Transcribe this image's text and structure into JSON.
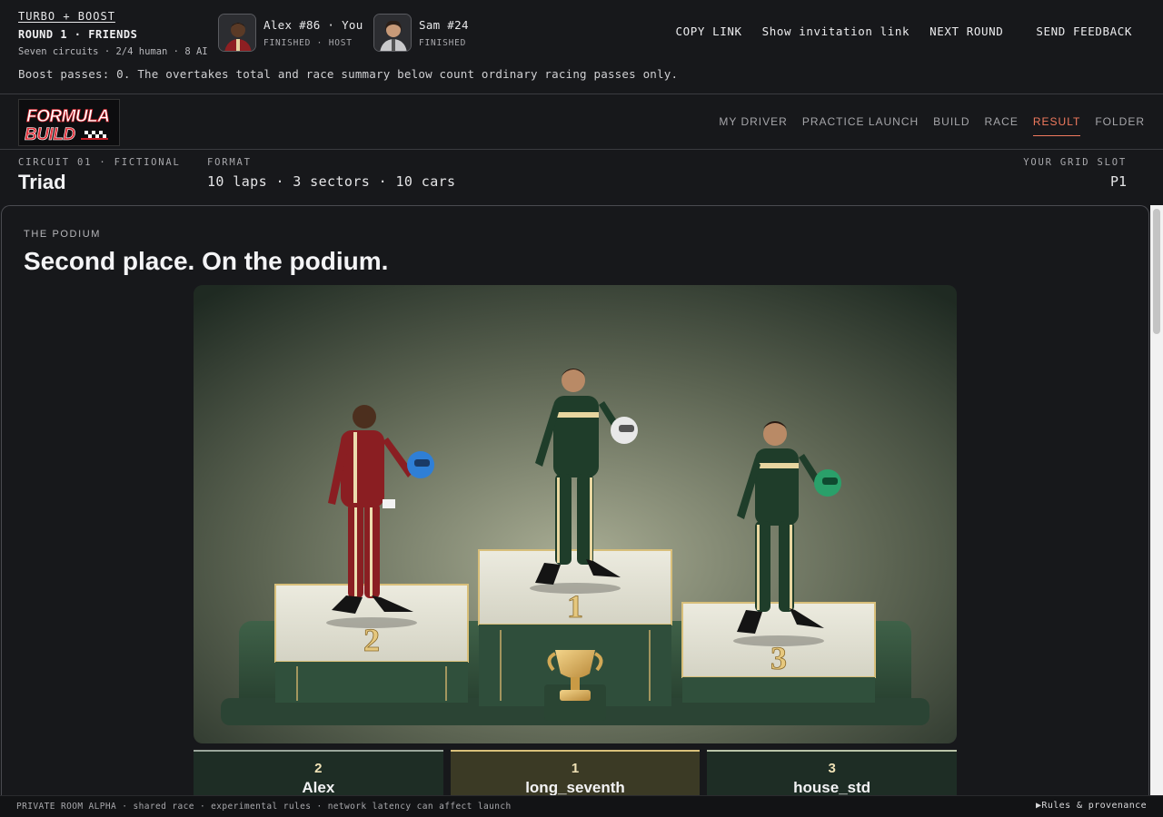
{
  "room": {
    "title": "TURBO + BOOST",
    "round": "ROUND 1 · FRIENDS",
    "meta": "Seven circuits · 2/4 human · 8 AI"
  },
  "players": [
    {
      "name": "Alex #86 · You",
      "status": "FINISHED · HOST",
      "suit_color": "#8e1f22"
    },
    {
      "name": "Sam #24",
      "status": "FINISHED",
      "suit_color": "#c8c8c8"
    }
  ],
  "top_actions": {
    "copy_link": "COPY LINK",
    "show_invite": "Show invitation link",
    "next_round": "NEXT ROUND",
    "send_feedback": "SEND FEEDBACK"
  },
  "boost_note": "Boost passes: 0. The overtakes total and race summary below count ordinary racing passes only.",
  "logo": {
    "line1": "FORMULA",
    "line2": "BUILD"
  },
  "nav": {
    "items": [
      "MY DRIVER",
      "PRACTICE LAUNCH",
      "BUILD",
      "RACE",
      "RESULT",
      "FOLDER"
    ],
    "active": "RESULT"
  },
  "circuit": {
    "label": "CIRCUIT 01 · FICTIONAL",
    "name": "Triad",
    "format_label": "FORMAT",
    "format": "10 laps · 3 sectors · 10 cars",
    "grid_label": "YOUR GRID SLOT",
    "grid_value": "P1"
  },
  "podium": {
    "kicker": "THE PODIUM",
    "heading": "Second place. On the podium.",
    "steps": {
      "second": "2",
      "first": "1",
      "third": "3"
    },
    "results": [
      {
        "pos": "2",
        "name": "Alex"
      },
      {
        "pos": "1",
        "name": "long_seventh"
      },
      {
        "pos": "3",
        "name": "house_std"
      }
    ],
    "colors": {
      "second_suit": "#8a1e22",
      "first_suit": "#1f3d2a",
      "third_suit": "#1f3d2a",
      "second_helmet": "#2f7fd6",
      "first_helmet": "#e8e8e8",
      "third_helmet": "#2aa06a"
    }
  },
  "footer": {
    "text": "PRIVATE ROOM ALPHA · shared race · experimental rules · network latency can affect launch",
    "link": "Rules & provenance"
  }
}
